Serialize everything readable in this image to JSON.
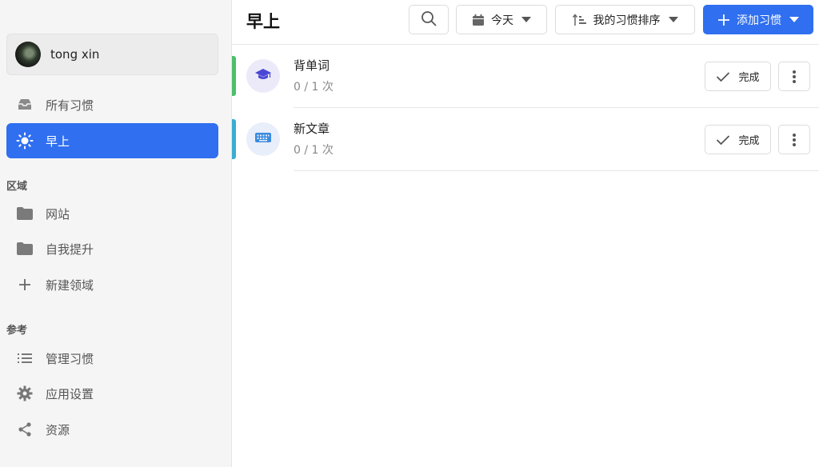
{
  "user": {
    "name": "tong xin"
  },
  "sidebar": {
    "items": [
      {
        "label": "所有习惯",
        "icon": "inbox-icon"
      },
      {
        "label": "早上",
        "icon": "sun-icon",
        "active": true
      }
    ],
    "areas_label": "区域",
    "areas": [
      {
        "label": "网站",
        "icon": "folder-icon"
      },
      {
        "label": "自我提升",
        "icon": "folder-icon"
      },
      {
        "label": "新建领域",
        "icon": "plus-icon"
      }
    ],
    "reference_label": "参考",
    "reference": [
      {
        "label": "管理习惯",
        "icon": "list-icon"
      },
      {
        "label": "应用设置",
        "icon": "gear-icon"
      },
      {
        "label": "资源",
        "icon": "share-icon"
      }
    ]
  },
  "header": {
    "title": "早上",
    "date_filter": "今天",
    "sort_label": "我的习惯排序",
    "add_label": "添加习惯"
  },
  "habits": [
    {
      "name": "背单词",
      "progress": "0 / 1 次",
      "accent": "#4cbf6b",
      "icon": "graduation-cap-icon",
      "icon_color": "#4a47d6",
      "done_label": "完成"
    },
    {
      "name": "新文章",
      "progress": "0 / 1 次",
      "accent": "#3aaed0",
      "icon": "keyboard-icon",
      "icon_color": "#3b8be0",
      "done_label": "完成"
    }
  ],
  "colors": {
    "primary": "#2f6ff0"
  }
}
